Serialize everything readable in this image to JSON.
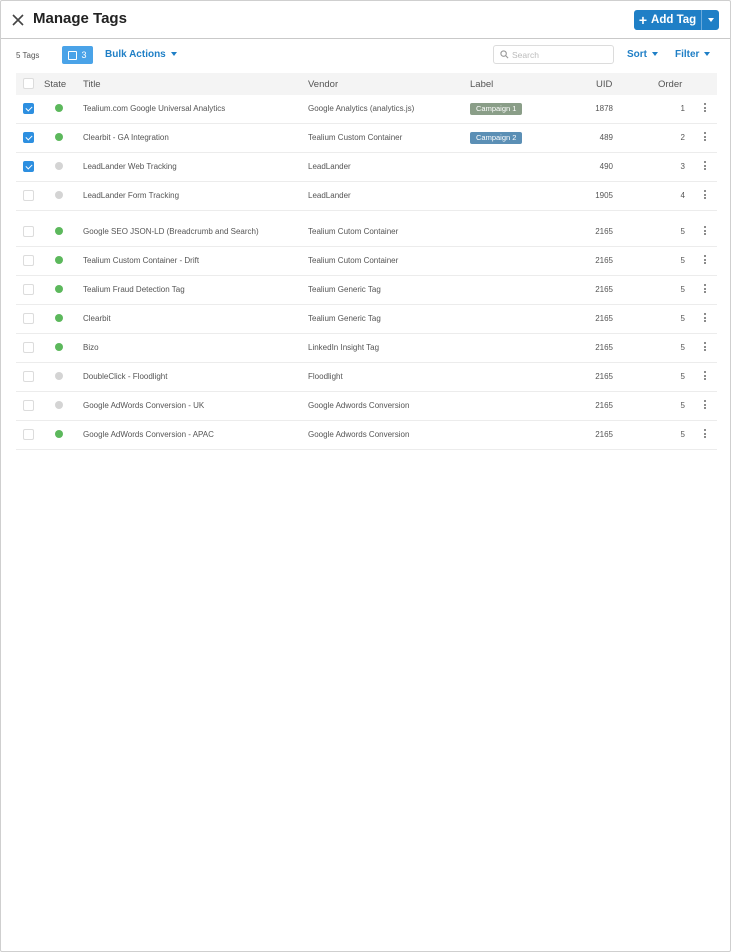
{
  "header": {
    "title": "Manage Tags",
    "add_tag_label": "Add Tag"
  },
  "toolbar": {
    "tag_count": "5 Tags",
    "selected_count": "3",
    "bulk_actions": "Bulk Actions",
    "search_placeholder": "Search",
    "sort": "Sort",
    "filter": "Filter"
  },
  "table": {
    "columns": {
      "state": "State",
      "title": "Title",
      "vendor": "Vendor",
      "label": "Label",
      "uid": "UID",
      "order": "Order"
    },
    "rows": [
      {
        "checked": true,
        "active": true,
        "title": "Tealium.com Google Universal Analytics",
        "vendor": "Google Analytics (analytics.js)",
        "label": "Campaign 1",
        "label_color": "#8a9e88",
        "uid": "1878",
        "order": "1"
      },
      {
        "checked": true,
        "active": true,
        "title": "Clearbit - GA Integration",
        "vendor": "Tealium Custom Container",
        "label": "Campaign 2",
        "label_color": "#5b8fb5",
        "uid": "489",
        "order": "2"
      },
      {
        "checked": true,
        "active": false,
        "title": "LeadLander Web Tracking",
        "vendor": "LeadLander",
        "label": "",
        "label_color": "",
        "uid": "490",
        "order": "3"
      },
      {
        "checked": false,
        "active": false,
        "title": "LeadLander Form Tracking",
        "vendor": "LeadLander",
        "label": "",
        "label_color": "",
        "uid": "1905",
        "order": "4"
      },
      {
        "checked": false,
        "active": true,
        "title": "Google SEO JSON-LD (Breadcrumb and Search)",
        "vendor": "Tealium Cutom Container",
        "label": "",
        "label_color": "",
        "uid": "2165",
        "order": "5",
        "gap_before": true
      },
      {
        "checked": false,
        "active": true,
        "title": "Tealium Custom Container - Drift",
        "vendor": "Tealium Cutom Container",
        "label": "",
        "label_color": "",
        "uid": "2165",
        "order": "5"
      },
      {
        "checked": false,
        "active": true,
        "title": "Tealium Fraud Detection Tag",
        "vendor": "Tealium Generic Tag",
        "label": "",
        "label_color": "",
        "uid": "2165",
        "order": "5"
      },
      {
        "checked": false,
        "active": true,
        "title": "Clearbit",
        "vendor": "Tealium Generic Tag",
        "label": "",
        "label_color": "",
        "uid": "2165",
        "order": "5"
      },
      {
        "checked": false,
        "active": true,
        "title": "Bizo",
        "vendor": "LinkedIn Insight Tag",
        "label": "",
        "label_color": "",
        "uid": "2165",
        "order": "5"
      },
      {
        "checked": false,
        "active": false,
        "title": "DoubleClick - Floodlight",
        "vendor": "Floodlight",
        "label": "",
        "label_color": "",
        "uid": "2165",
        "order": "5"
      },
      {
        "checked": false,
        "active": false,
        "title": "Google AdWords Conversion - UK",
        "vendor": "Google Adwords Conversion",
        "label": "",
        "label_color": "",
        "uid": "2165",
        "order": "5"
      },
      {
        "checked": false,
        "active": true,
        "title": "Google AdWords Conversion - APAC",
        "vendor": "Google Adwords Conversion",
        "label": "",
        "label_color": "",
        "uid": "2165",
        "order": "5"
      }
    ]
  },
  "colors": {
    "accent": "#1f7fc6",
    "active_dot": "#5cb85c",
    "inactive_dot": "#d4d4d4",
    "checkbox_checked": "#2d8fe0"
  },
  "icons": {
    "close": "close-icon",
    "plus": "plus-icon",
    "search": "search-icon",
    "menu": "kebab-icon"
  }
}
